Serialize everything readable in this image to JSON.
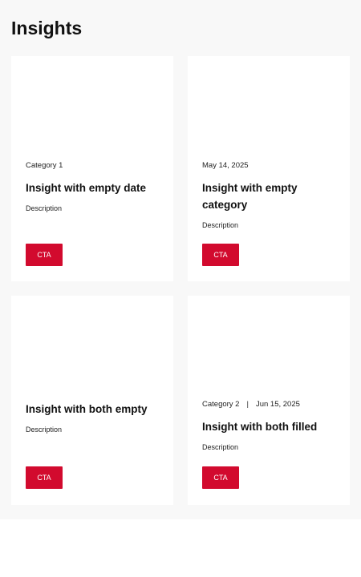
{
  "page": {
    "title": "Insights"
  },
  "cards": [
    {
      "category": "Category 1",
      "date": "",
      "title": "Insight with empty date",
      "description": "Description",
      "cta": "CTA"
    },
    {
      "category": "",
      "date": "May 14, 2025",
      "title": "Insight with empty category",
      "description": "Description",
      "cta": "CTA"
    },
    {
      "category": "",
      "date": "",
      "title": "Insight with both empty",
      "description": "Description",
      "cta": "CTA"
    },
    {
      "category": "Category 2",
      "separator": "|",
      "date": "Jun 15, 2025",
      "title": "Insight with both filled",
      "description": "Description",
      "cta": "CTA"
    }
  ]
}
